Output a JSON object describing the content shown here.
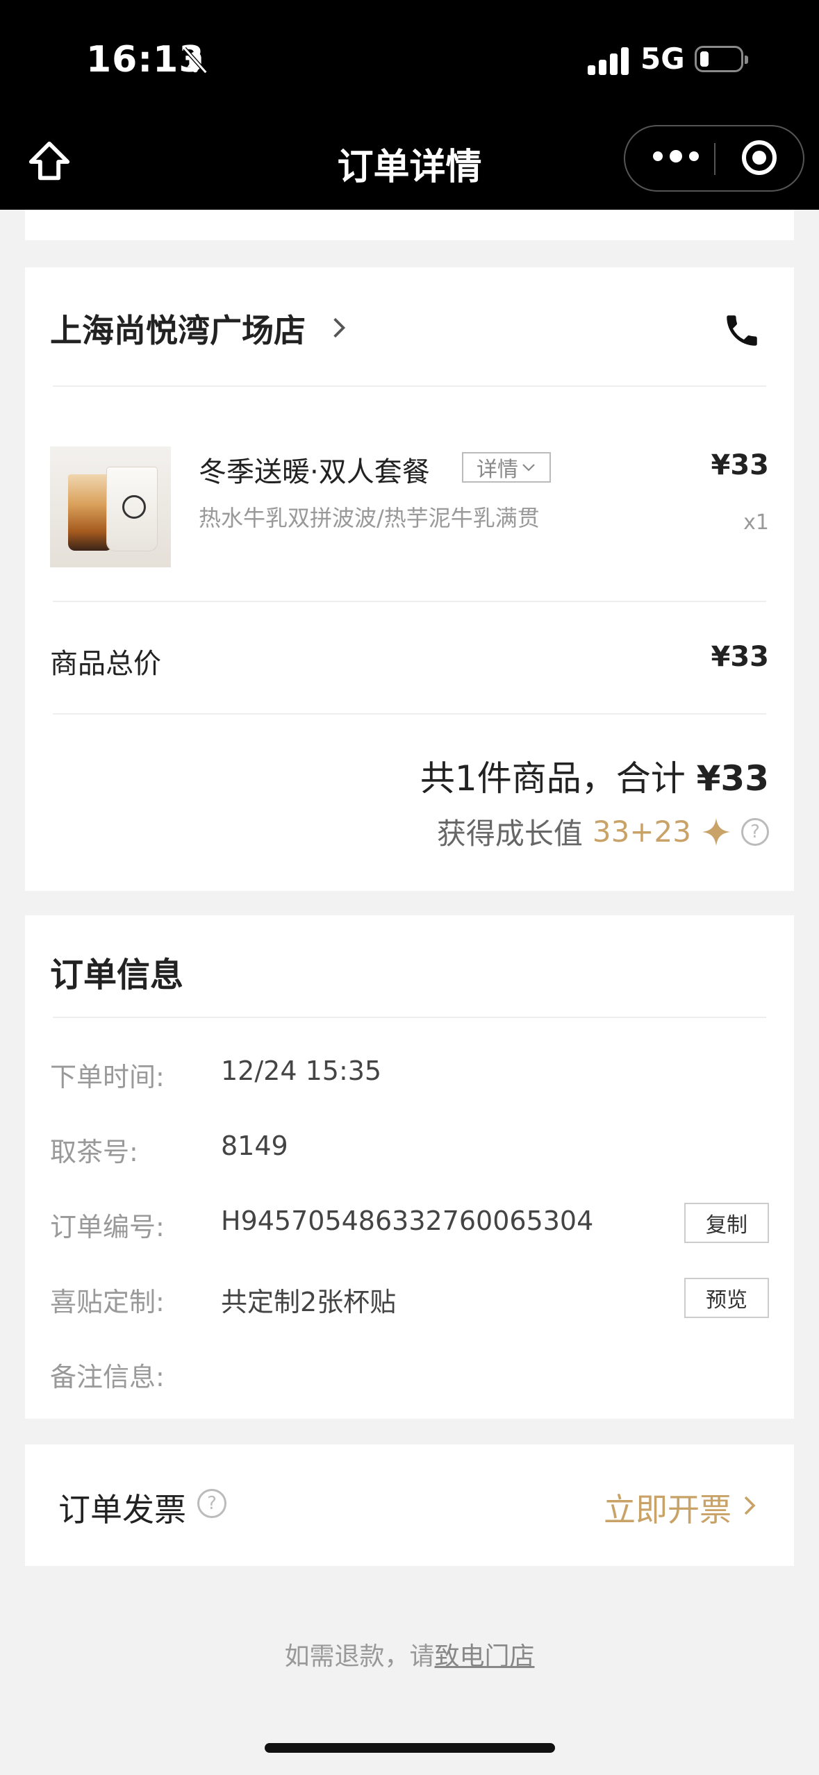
{
  "status_bar": {
    "time": "16:13",
    "network": "5G"
  },
  "nav": {
    "title": "订单详情"
  },
  "store": {
    "name": "上海尚悦湾广场店",
    "product": {
      "name": "冬季送暖·双人套餐",
      "detail_label": "详情",
      "spec": "热水牛乳双拼波波/热芋泥牛乳满贯",
      "price": "¥33",
      "qty": "x1"
    },
    "subtotal_label": "商品总价",
    "subtotal_value": "¥33",
    "summary_prefix": "共1件商品，合计",
    "summary_total": "¥33",
    "growth_label": "获得成长值",
    "growth_value": "33+23",
    "help_glyph": "?"
  },
  "order_info": {
    "title": "订单信息",
    "rows": [
      {
        "label": "下单时间:",
        "value": "12/24 15:35"
      },
      {
        "label": "取茶号:",
        "value": "8149"
      },
      {
        "label": "订单编号:",
        "value": "H9457054863327600653​04",
        "button": "复制"
      },
      {
        "label": "喜贴定制:",
        "value": "共定制2张杯贴",
        "button": "预览"
      },
      {
        "label": "备注信息:",
        "value": ""
      }
    ]
  },
  "invoice": {
    "label": "订单发票",
    "help_glyph": "?",
    "action": "立即开票"
  },
  "footer": {
    "refund_text": "如需退款，请",
    "refund_link": "致电门店"
  },
  "colors": {
    "accent_gold": "#c8a267",
    "top_bar": "#000000",
    "page_bg": "#f2f2f2"
  }
}
